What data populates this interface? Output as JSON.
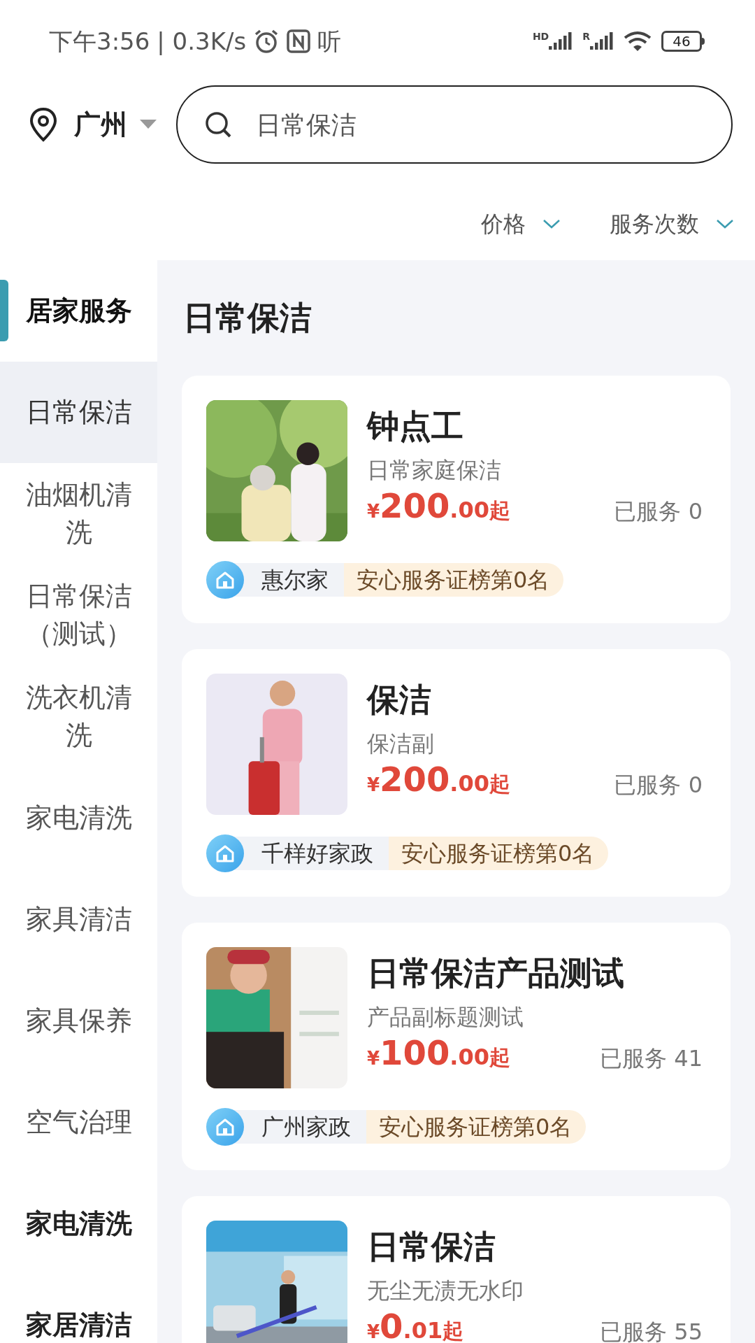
{
  "status_bar": {
    "time": "下午3:56",
    "speed": "| 0.3K/s",
    "app_glyph": "听",
    "sim1_label": "HD",
    "sim2_label": "R",
    "battery": "46"
  },
  "header": {
    "city": "广州",
    "search": {
      "placeholder": "日常保洁"
    }
  },
  "filters": [
    {
      "label": "价格"
    },
    {
      "label": "服务次数"
    }
  ],
  "sidebar": {
    "categories": [
      {
        "label": "居家服务",
        "selected": true,
        "children": [
          {
            "label": "日常保洁",
            "selected": true
          },
          {
            "label": "油烟机清洗",
            "selected": false
          },
          {
            "label": "日常保洁（测试）",
            "selected": false
          },
          {
            "label": "洗衣机清洗",
            "selected": false
          },
          {
            "label": "家电清洗",
            "selected": false
          },
          {
            "label": "家具清洁",
            "selected": false
          },
          {
            "label": "家具保养",
            "selected": false
          },
          {
            "label": "空气治理",
            "selected": false
          }
        ]
      },
      {
        "label": "家电清洗",
        "selected": false
      },
      {
        "label": "家居清洁",
        "selected": false
      }
    ]
  },
  "section_title": "日常保洁",
  "services": [
    {
      "title": "钟点工",
      "subtitle": "日常家庭保洁",
      "price": {
        "currency": "¥",
        "integer": "200",
        "decimal": ".00",
        "suffix": "起"
      },
      "served": "已服务 0",
      "store": "惠尔家",
      "rank": "安心服务证榜第0名"
    },
    {
      "title": "保洁",
      "subtitle": "保洁副",
      "price": {
        "currency": "¥",
        "integer": "200",
        "decimal": ".00",
        "suffix": "起"
      },
      "served": "已服务 0",
      "store": "千样好家政",
      "rank": "安心服务证榜第0名"
    },
    {
      "title": "日常保洁产品测试",
      "subtitle": "产品副标题测试",
      "price": {
        "currency": "¥",
        "integer": "100",
        "decimal": ".00",
        "suffix": "起"
      },
      "served": "已服务 41",
      "store": "广州家政",
      "rank": "安心服务证榜第0名"
    },
    {
      "title": "日常保洁",
      "subtitle": "无尘无渍无水印",
      "price": {
        "currency": "¥",
        "integer": "0",
        "decimal": ".01",
        "suffix": "起"
      },
      "served": "已服务 55"
    }
  ]
}
